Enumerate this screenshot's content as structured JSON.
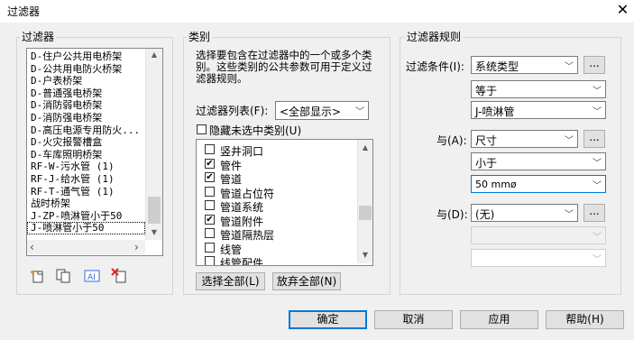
{
  "window": {
    "title": "过滤器",
    "close_glyph": "✕"
  },
  "filters": {
    "label": "过滤器",
    "items": [
      "D-住户公共用电桥架",
      "D-公共用电防火桥架",
      "D-户表桥架",
      "D-普通强电桥架",
      "D-消防弱电桥架",
      "D-消防强电桥架",
      "D-高压电源专用防火...",
      "D-火灾报警槽盒",
      "D-车库照明桥架",
      "RF-W-污水管 (1)",
      "RF-J-给水管 (1)",
      "RF-T-通气管 (1)",
      "战时桥架",
      "J-ZP-喷淋管小于50",
      "J-喷淋管小于50"
    ],
    "selected_index": 14,
    "toolbar_icons": [
      "new-filter-icon",
      "duplicate-filter-icon",
      "rename-filter-icon",
      "delete-filter-icon"
    ]
  },
  "categories": {
    "label": "类别",
    "description": "选择要包含在过滤器中的一个或多个类别。这些类别的公共参数可用于定义过滤器规则。",
    "filter_list_label": "过滤器列表(F):",
    "filter_list_value": "<全部显示>",
    "hide_unchecked_label": "隐藏未选中类别(U)",
    "hide_unchecked_checked": false,
    "items": [
      {
        "label": "竖井洞口",
        "checked": false
      },
      {
        "label": "管件",
        "checked": true
      },
      {
        "label": "管道",
        "checked": true
      },
      {
        "label": "管道占位符",
        "checked": false
      },
      {
        "label": "管道系统",
        "checked": false
      },
      {
        "label": "管道附件",
        "checked": true
      },
      {
        "label": "管道隔热层",
        "checked": false
      },
      {
        "label": "线管",
        "checked": false
      },
      {
        "label": "线管配件",
        "checked": false
      }
    ],
    "select_all_label": "选择全部(L)",
    "deselect_all_label": "放弃全部(N)"
  },
  "rules": {
    "label": "过滤器规则",
    "condition_label": "过滤条件(I):",
    "condition_param": "系统类型",
    "condition_operator": "等于",
    "condition_value": "J-喷淋管",
    "and1_label": "与(A):",
    "and1_param": "尺寸",
    "and1_operator": "小于",
    "and1_value": "50 mmø",
    "and2_label": "与(D):",
    "and2_param": "(无)",
    "ellipsis": "..."
  },
  "buttons": {
    "ok": "确定",
    "cancel": "取消",
    "apply": "应用",
    "help": "帮助(H)"
  }
}
